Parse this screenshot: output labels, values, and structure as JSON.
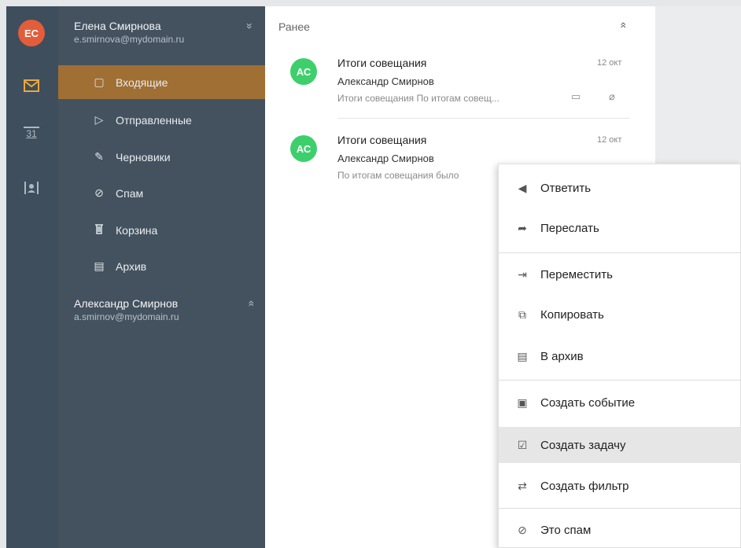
{
  "rail": {
    "avatar_initials": "ЕС",
    "calendar_label": "31",
    "icons": [
      "envelope-icon",
      "calendar-icon",
      "contacts-icon"
    ]
  },
  "accounts": [
    {
      "name": "Елена Смирнова",
      "email": "e.smirnova@mydomain.ru",
      "chevron": "»"
    },
    {
      "name": "Александр Смирнов",
      "email": "a.smirnov@mydomain.ru",
      "chevron": "»"
    }
  ],
  "folders": [
    {
      "label": "Входящие",
      "icon": "inbox-icon",
      "glyph": "▢"
    },
    {
      "label": "Отправленные",
      "icon": "send-icon",
      "glyph": "▷"
    },
    {
      "label": "Черновики",
      "icon": "draft-icon",
      "glyph": "✎"
    },
    {
      "label": "Спам",
      "icon": "spam-icon",
      "glyph": "⊘"
    },
    {
      "label": "Корзина",
      "icon": "trash-icon",
      "glyph": "🗑"
    },
    {
      "label": "Архив",
      "icon": "archive-icon",
      "glyph": "▤"
    }
  ],
  "mail": {
    "section_title": "Ранее",
    "messages": [
      {
        "initials": "АС",
        "subject": "Итоги совещания",
        "from": "Александр Смирнов",
        "preview": "Итоги совещания По итогам совещ...",
        "date": "12 окт"
      },
      {
        "initials": "АС",
        "subject": "Итоги совещания",
        "from": "Александр Смирнов",
        "preview": "По итогам совещания было",
        "date": "12 окт"
      }
    ]
  },
  "context_menu": {
    "items": [
      {
        "label": "Ответить",
        "icon": "reply-icon",
        "glyph": "◀"
      },
      {
        "label": "Переслать",
        "icon": "forward-icon",
        "glyph": "➦"
      },
      {
        "label": "Переместить",
        "icon": "move-icon",
        "glyph": "⇥"
      },
      {
        "label": "Копировать",
        "icon": "copy-icon",
        "glyph": "⧉"
      },
      {
        "label": "В архив",
        "icon": "archive-icon",
        "glyph": "▤"
      },
      {
        "label": "Создать событие",
        "icon": "event-icon",
        "glyph": "▣"
      },
      {
        "label": "Создать задачу",
        "icon": "task-icon",
        "glyph": "☑"
      },
      {
        "label": "Создать фильтр",
        "icon": "filter-icon",
        "glyph": "⇄"
      },
      {
        "label": "Это спам",
        "icon": "spam-icon",
        "glyph": "⊘"
      }
    ]
  },
  "colors": {
    "rail_bg": "#3f4e5c",
    "sidebar_bg": "#44525f",
    "active_folder": "#a06f33",
    "avatar_user": "#e35d3b",
    "avatar_sender": "#3ecf6d",
    "envelope_accent": "#f0a73b"
  }
}
